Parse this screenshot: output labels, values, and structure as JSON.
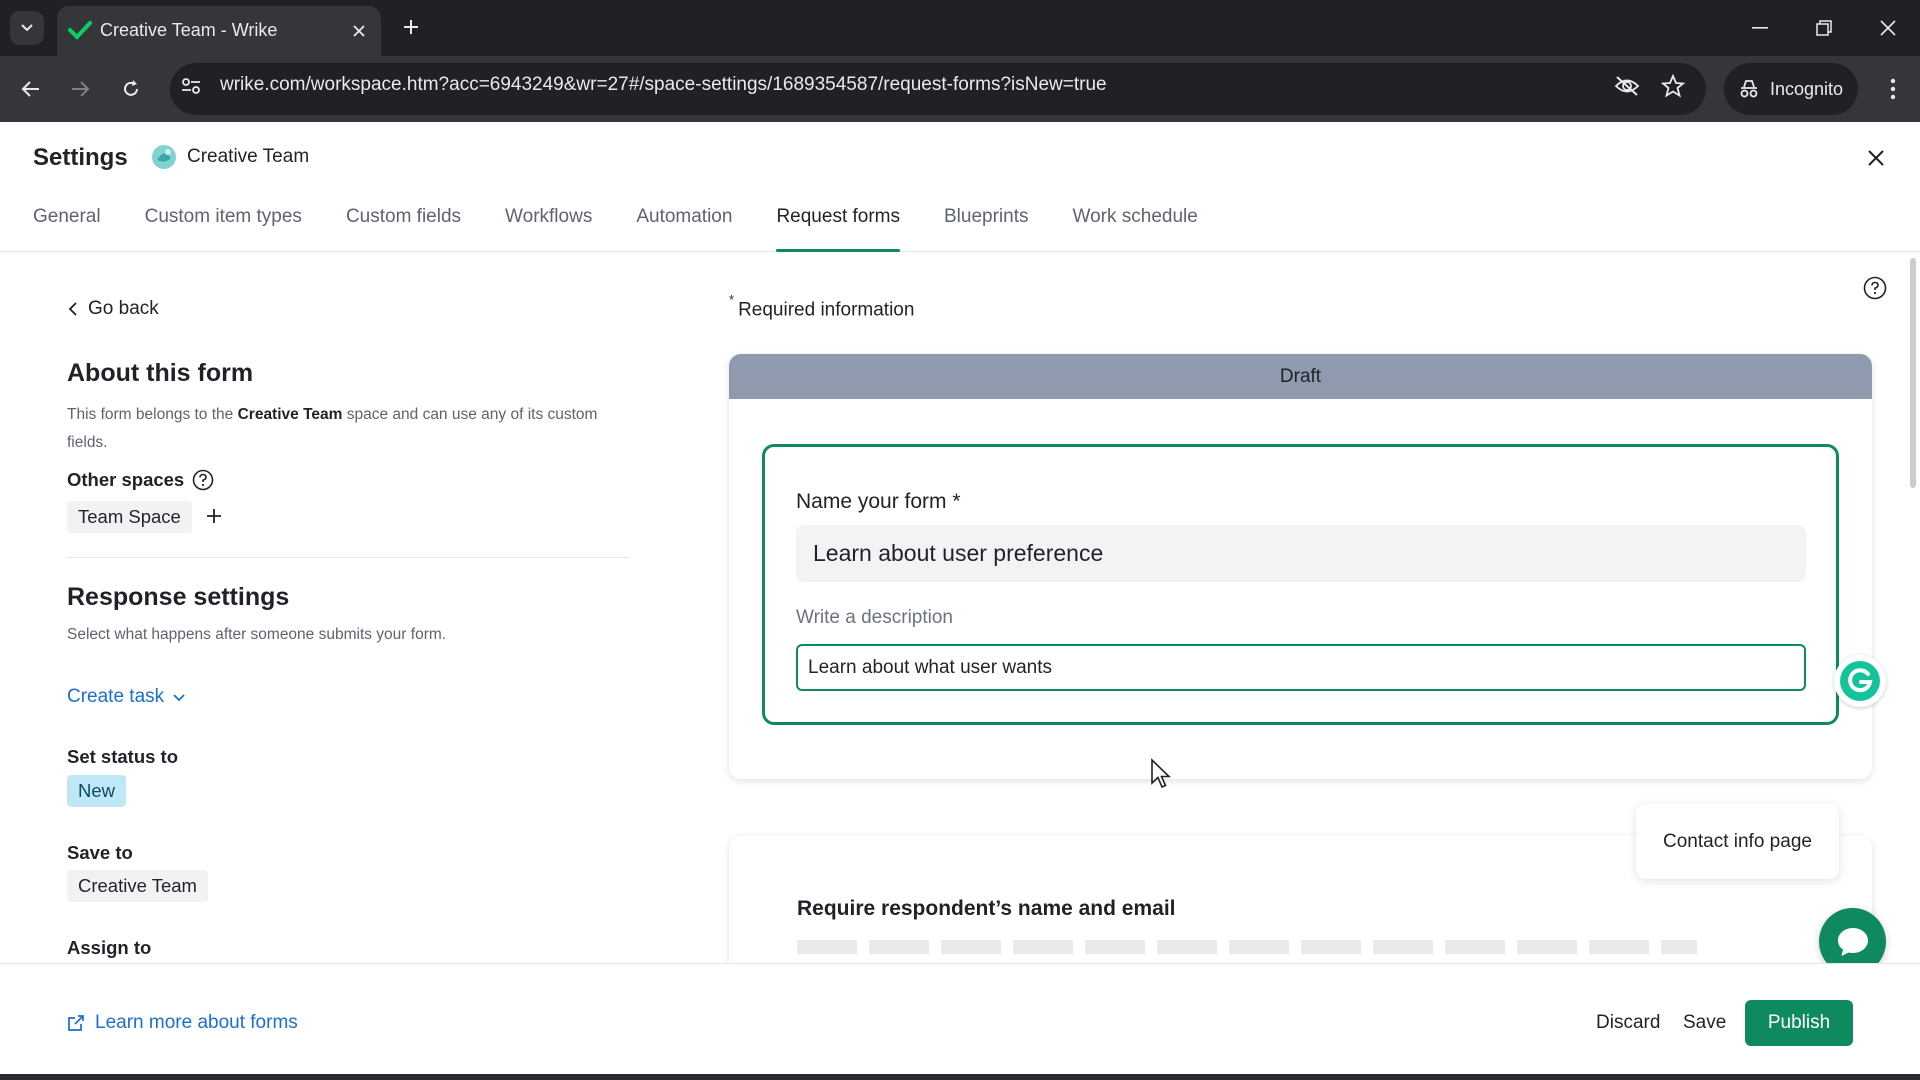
{
  "browser": {
    "tab_title": "Creative Team - Wrike",
    "url": "wrike.com/workspace.htm?acc=6943249&wr=27#/space-settings/1689354587/request-forms?isNew=true",
    "incognito_label": "Incognito"
  },
  "settings": {
    "title": "Settings",
    "space_name": "Creative Team",
    "tabs": [
      "General",
      "Custom item types",
      "Custom fields",
      "Workflows",
      "Automation",
      "Request forms",
      "Blueprints",
      "Work schedule"
    ],
    "active_tab": "Request forms"
  },
  "left": {
    "go_back": "Go back",
    "about_title": "About this form",
    "about_text_1": "This form belongs to the ",
    "about_text_space": "Creative Team",
    "about_text_2": " space and can use any of its custom fields.",
    "other_spaces_label": "Other spaces",
    "other_space_chip": "Team Space",
    "response_title": "Response settings",
    "response_sub": "Select what happens after someone submits your form.",
    "create_task": "Create task",
    "set_status_label": "Set status to",
    "status_value": "New",
    "save_to_label": "Save to",
    "save_to_value": "Creative Team",
    "assign_to_label": "Assign to"
  },
  "main": {
    "required_mark": "*",
    "required_info": "Required information",
    "draft_label": "Draft",
    "name_label": "Name your form *",
    "name_value": "Learn about user preference",
    "desc_label": "Write a description",
    "desc_value": "Learn about what user wants",
    "contact_pill": "Contact info page",
    "card2_title": "Require respondent’s name and email"
  },
  "footer": {
    "learn_more": "Learn more about forms",
    "discard": "Discard",
    "save": "Save",
    "publish": "Publish"
  },
  "colors": {
    "accent_green": "#0f8a5f",
    "link_blue": "#1a6fd0",
    "draft_bar": "#8f9aae",
    "status_chip": "#bfe8f6"
  }
}
